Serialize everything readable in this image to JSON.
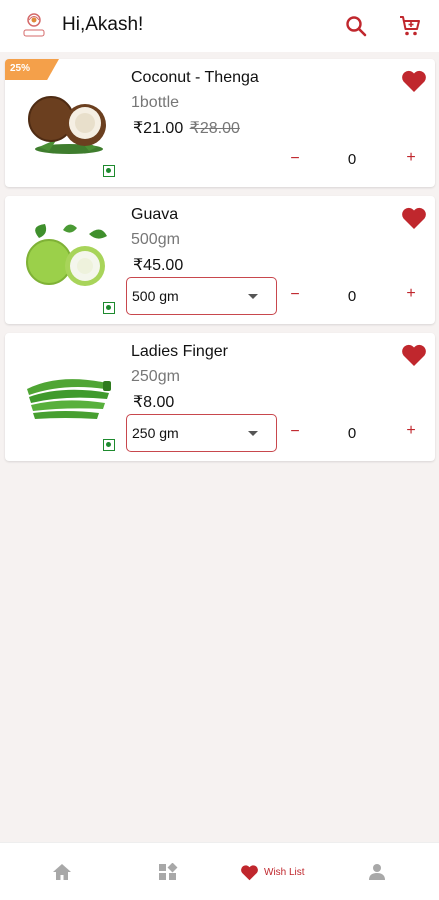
{
  "header": {
    "greeting": "Hi,Akash!",
    "logo_icon": "mystore-logo",
    "search_icon": "search-icon",
    "cart_icon": "cart-icon",
    "accent_color": "#c0272d"
  },
  "products": [
    {
      "badge": "25%",
      "name": "Coconut - Thenga",
      "quantity": "1bottle",
      "price": "₹21.00",
      "mrp": "₹28.00",
      "count": "0",
      "wishlisted": true
    },
    {
      "name": "Guava",
      "quantity": "500gm",
      "price": "₹45.00",
      "selected_option": "500 gm",
      "count": "0",
      "wishlisted": true
    },
    {
      "name": "Ladies Finger",
      "quantity": "250gm",
      "price": "₹8.00",
      "selected_option": "250 gm",
      "count": "0",
      "wishlisted": true
    }
  ],
  "stepper": {
    "minus": "−",
    "plus": "+"
  },
  "bottom_nav": {
    "home_icon": "home-icon",
    "categories_icon": "categories-icon",
    "wishlist_label": "Wish List",
    "wishlist_icon": "heart-icon",
    "account_icon": "user-icon",
    "active": "wishlist"
  }
}
